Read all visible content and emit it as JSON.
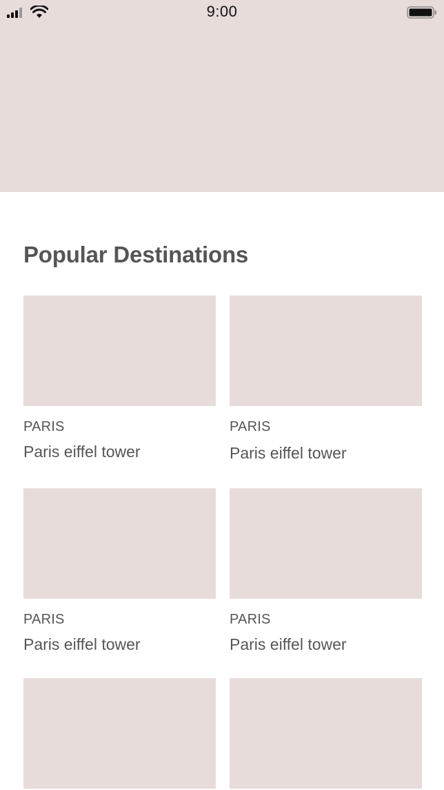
{
  "status_bar": {
    "time": "9:00",
    "icons": [
      "signal-icon",
      "wifi-icon",
      "battery-icon"
    ]
  },
  "section": {
    "title": "Popular Destinations"
  },
  "destinations": [
    {
      "label": "PARIS",
      "title": "Paris eiffel tower"
    },
    {
      "label": "PARIS",
      "title": "Paris eiffel tower"
    },
    {
      "label": "PARIS",
      "title": "Paris eiffel tower"
    },
    {
      "label": "PARIS",
      "title": "Paris eiffel tower"
    },
    {
      "label": "",
      "title": ""
    },
    {
      "label": "",
      "title": ""
    }
  ],
  "colors": {
    "placeholder": "#e8dcdb",
    "text": "#555555",
    "background": "#ffffff"
  }
}
